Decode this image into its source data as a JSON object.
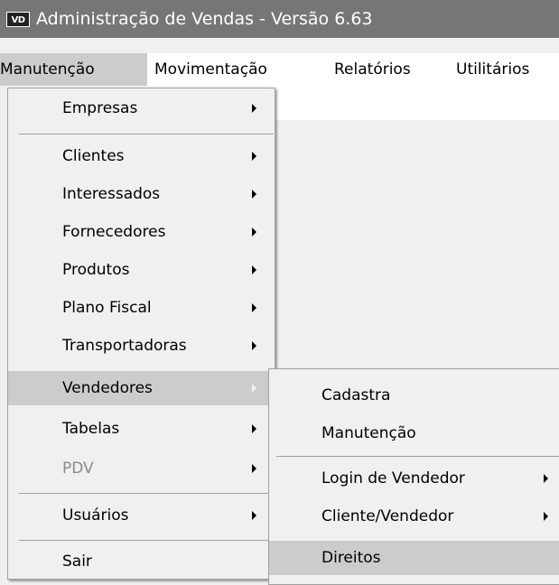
{
  "window": {
    "icon_text": "VD",
    "title": "Administração de Vendas - Versão 6.63"
  },
  "menubar": {
    "items": [
      {
        "label": "Manutenção",
        "active": true
      },
      {
        "label": "Movimentação"
      },
      {
        "label": "Relatórios"
      },
      {
        "label": "Utilitários"
      }
    ]
  },
  "menu_manutencao": {
    "items": [
      {
        "label": "Empresas",
        "has_submenu": true
      },
      {
        "label": "Clientes",
        "has_submenu": true
      },
      {
        "label": "Interessados",
        "has_submenu": true
      },
      {
        "label": "Fornecedores",
        "has_submenu": true
      },
      {
        "label": "Produtos",
        "has_submenu": true
      },
      {
        "label": "Plano Fiscal",
        "has_submenu": true
      },
      {
        "label": "Transportadoras",
        "has_submenu": true
      },
      {
        "label": "Vendedores",
        "has_submenu": true,
        "highlighted": true
      },
      {
        "label": "Tabelas",
        "has_submenu": true
      },
      {
        "label": "PDV",
        "has_submenu": true,
        "disabled": true
      },
      {
        "label": "Usuários",
        "has_submenu": true
      },
      {
        "label": "Sair"
      }
    ]
  },
  "submenu_vendedores": {
    "items": [
      {
        "label": "Cadastra"
      },
      {
        "label": "Manutenção"
      },
      {
        "label": "Login de Vendedor",
        "has_submenu": true
      },
      {
        "label": "Cliente/Vendedor",
        "has_submenu": true
      },
      {
        "label": "Direitos",
        "highlighted": true
      }
    ]
  },
  "colors": {
    "titlebar": "#767676",
    "menu_background": "#f0f0f0",
    "highlight": "#cccccc",
    "disabled_text": "#8a8a8a"
  }
}
